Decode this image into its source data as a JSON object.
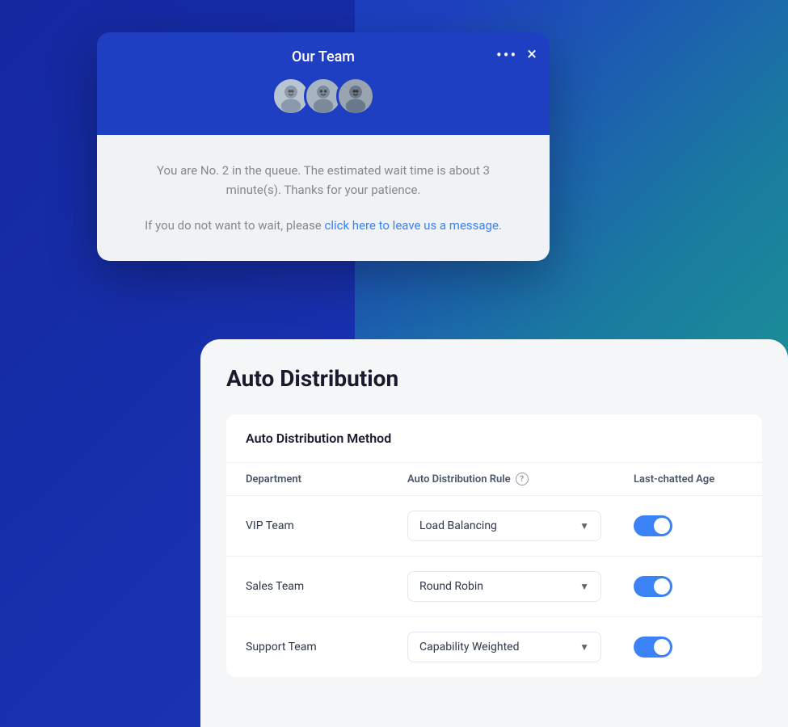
{
  "background": {
    "gradient_start": "#1428a0",
    "gradient_end": "#1aaa8a"
  },
  "chat_widget": {
    "header": {
      "title": "Our Team",
      "dots_label": "•••",
      "close_label": "×",
      "avatars": [
        {
          "id": 1,
          "label": "Agent 1",
          "emoji": "👩"
        },
        {
          "id": 2,
          "label": "Agent 2",
          "emoji": "👨"
        },
        {
          "id": 3,
          "label": "Agent 3",
          "emoji": "👩"
        }
      ]
    },
    "body": {
      "queue_text": "You are No. 2 in the queue. The estimated wait time is about 3 minute(s). Thanks for your patience.",
      "leave_text_before": "If you do not want to wait, please ",
      "leave_link": "click here to leave us a message",
      "leave_text_after": "."
    }
  },
  "auto_distribution": {
    "title": "Auto Distribution",
    "method_section": {
      "title": "Auto Distribution Method",
      "columns": {
        "department": "Department",
        "rule": "Auto Distribution Rule",
        "last_chatted": "Last-chatted Age"
      },
      "rows": [
        {
          "department": "VIP Team",
          "rule": "Load Balancing",
          "toggle_on": true
        },
        {
          "department": "Sales Team",
          "rule": "Round Robin",
          "toggle_on": true
        },
        {
          "department": "Support Team",
          "rule": "Capability Weighted",
          "toggle_on": true
        }
      ]
    }
  }
}
